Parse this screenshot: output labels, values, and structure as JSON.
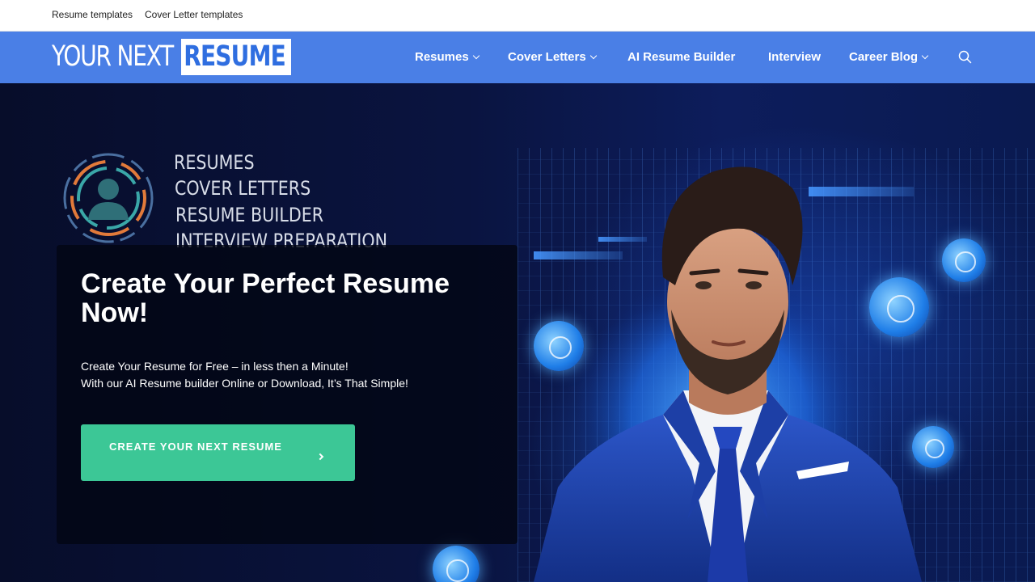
{
  "topbar": {
    "links": [
      {
        "label": "Resume templates"
      },
      {
        "label": "Cover Letter templates"
      }
    ]
  },
  "logo": {
    "light": "YOUR NEXT",
    "bold": "RESUME"
  },
  "nav": {
    "items": [
      {
        "label": "Resumes",
        "dropdown": true
      },
      {
        "label": "Cover Letters",
        "dropdown": true
      },
      {
        "label": "AI Resume Builder",
        "dropdown": false
      },
      {
        "label": "Interview",
        "dropdown": false
      },
      {
        "label": "Career Blog",
        "dropdown": true
      }
    ],
    "search_icon": "search-icon"
  },
  "hero": {
    "tags": [
      "RESUMES",
      "COVER LETTERS",
      "RESUME BUILDER",
      "INTERVIEW PREPARATION"
    ],
    "title": "Create Your Perfect Resume Now!",
    "line1": "Create Your Resume for Free – in less then a Minute!",
    "line2": "With our AI Resume builder Online or Download, It’s That Simple!",
    "cta_label": "CREATE YOUR NEXT RESUME"
  },
  "colors": {
    "nav_bg": "#4a7fe6",
    "cta_bg": "#3cc796",
    "logo_accent": "#2f6ee0"
  }
}
